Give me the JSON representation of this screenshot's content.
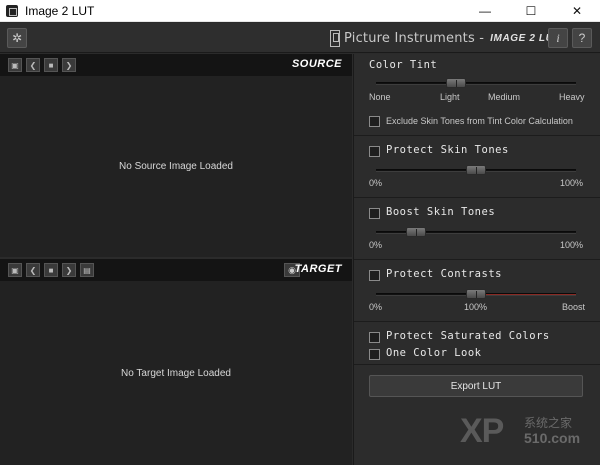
{
  "window": {
    "title": "Image 2 LUT",
    "minimize": "—",
    "maximize": "☐",
    "close": "✕"
  },
  "header": {
    "settings_icon": "gear-icon",
    "brand_name": "Picture Instruments  -",
    "product_name": "IMAGE 2 LUT",
    "info_label": "i",
    "help_label": "?"
  },
  "source": {
    "title": "SOURCE",
    "empty_text": "No Source Image Loaded",
    "tools": [
      "save-icon",
      "prev-icon",
      "folder-icon",
      "next-icon"
    ]
  },
  "target": {
    "title": "TARGET",
    "empty_text": "No Target Image Loaded",
    "tools": [
      "save-icon",
      "prev-icon",
      "folder-icon",
      "next-icon",
      "save-as-icon"
    ]
  },
  "color_tint": {
    "title": "Color Tint",
    "labels": [
      "None",
      "Light",
      "Medium",
      "Heavy"
    ],
    "value": 0.4,
    "exclude_label": "Exclude Skin Tones from Tint Color Calculation",
    "exclude_checked": false
  },
  "protect_skin": {
    "label": "Protect Skin Tones",
    "checked": false,
    "min": "0%",
    "max": "100%",
    "value": 0.5
  },
  "boost_skin": {
    "label": "Boost Skin Tones",
    "checked": false,
    "min": "0%",
    "max": "100%",
    "value": 0.2
  },
  "protect_contrasts": {
    "label": "Protect Contrasts",
    "checked": false,
    "min": "0%",
    "mid": "100%",
    "max": "Boost",
    "value": 0.5
  },
  "protect_saturated": {
    "label": "Protect Saturated Colors",
    "checked": false
  },
  "one_color": {
    "label": "One Color Look",
    "checked": false
  },
  "export": {
    "label": "Export LUT"
  },
  "watermark": {
    "brand": "XP",
    "cn": "系统之家",
    "num": "510.com"
  },
  "colors": {
    "background": "#2b2b2b",
    "panel": "#222222",
    "header_bar": "#141414",
    "accent_red": "#8a2a24"
  }
}
